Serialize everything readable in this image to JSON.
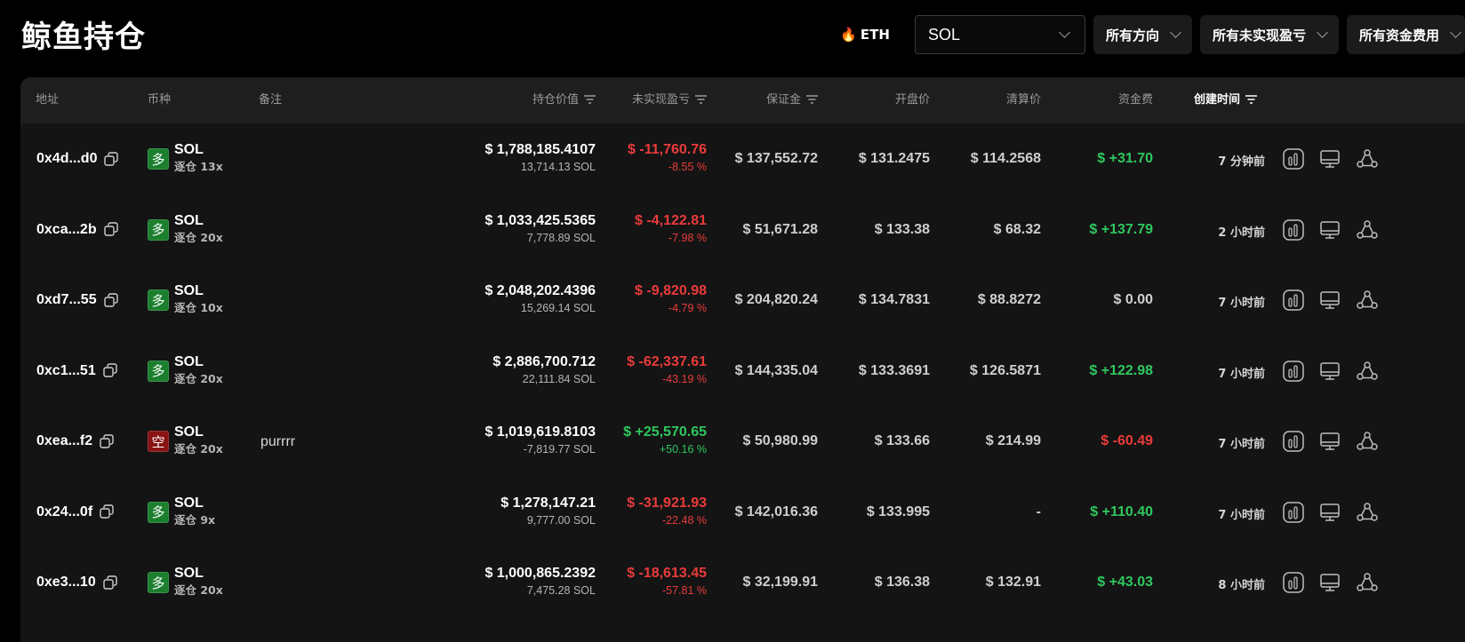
{
  "title": "鲸鱼持仓",
  "filters": {
    "hot_coin_label": "ETH",
    "coin_value": "SOL",
    "direction_label": "所有方向",
    "pnl_label": "所有未实现盈亏",
    "funding_label": "所有资金费用"
  },
  "columns": {
    "address": "地址",
    "coin": "币种",
    "note": "备注",
    "position_value": "持仓价值",
    "unrealized_pnl": "未实现盈亏",
    "margin": "保证金",
    "entry_price": "开盘价",
    "liq_price": "清算价",
    "funding": "资金费",
    "created": "创建时间"
  },
  "colors": {
    "long": "#1b7f2e",
    "short": "#8a1313",
    "profit": "#2fc75f",
    "loss": "#ea3b3b"
  },
  "icons": {
    "hot": "fire-icon",
    "copy": "copy-icon",
    "filter": "filter-icon",
    "actions": [
      "chart-icon",
      "monitor-icon",
      "share-icon"
    ]
  },
  "rows": [
    {
      "address": "0x4d...d0",
      "side": "多",
      "side_type": "long",
      "coin": "SOL",
      "leverage": "逐仓 13x",
      "note": "",
      "value": "$ 1,788,185.4107",
      "size": "13,714.13 SOL",
      "pnl": "$ -11,760.76",
      "pnl_pct": "-8.55 %",
      "pnl_type": "loss",
      "margin": "$ 137,552.72",
      "entry": "$ 131.2475",
      "liq": "$ 114.2568",
      "funding": "$ +31.70",
      "funding_type": "profit",
      "created": "7 分钟前"
    },
    {
      "address": "0xca...2b",
      "side": "多",
      "side_type": "long",
      "coin": "SOL",
      "leverage": "逐仓 20x",
      "note": "",
      "value": "$ 1,033,425.5365",
      "size": "7,778.89 SOL",
      "pnl": "$ -4,122.81",
      "pnl_pct": "-7.98 %",
      "pnl_type": "loss",
      "margin": "$ 51,671.28",
      "entry": "$ 133.38",
      "liq": "$ 68.32",
      "funding": "$ +137.79",
      "funding_type": "profit",
      "created": "2 小时前"
    },
    {
      "address": "0xd7...55",
      "side": "多",
      "side_type": "long",
      "coin": "SOL",
      "leverage": "逐仓 10x",
      "note": "",
      "value": "$ 2,048,202.4396",
      "size": "15,269.14 SOL",
      "pnl": "$ -9,820.98",
      "pnl_pct": "-4.79 %",
      "pnl_type": "loss",
      "margin": "$ 204,820.24",
      "entry": "$ 134.7831",
      "liq": "$ 88.8272",
      "funding": "$ 0.00",
      "funding_type": "neutral",
      "created": "7 小时前"
    },
    {
      "address": "0xc1...51",
      "side": "多",
      "side_type": "long",
      "coin": "SOL",
      "leverage": "逐仓 20x",
      "note": "",
      "value": "$ 2,886,700.712",
      "size": "22,111.84 SOL",
      "pnl": "$ -62,337.61",
      "pnl_pct": "-43.19 %",
      "pnl_type": "loss",
      "margin": "$ 144,335.04",
      "entry": "$ 133.3691",
      "liq": "$ 126.5871",
      "funding": "$ +122.98",
      "funding_type": "profit",
      "created": "7 小时前"
    },
    {
      "address": "0xea...f2",
      "side": "空",
      "side_type": "short",
      "coin": "SOL",
      "leverage": "逐仓 20x",
      "note": "purrrr",
      "value": "$ 1,019,619.8103",
      "size": "-7,819.77 SOL",
      "pnl": "$ +25,570.65",
      "pnl_pct": "+50.16 %",
      "pnl_type": "profit",
      "margin": "$ 50,980.99",
      "entry": "$ 133.66",
      "liq": "$ 214.99",
      "funding": "$ -60.49",
      "funding_type": "loss",
      "created": "7 小时前"
    },
    {
      "address": "0x24...0f",
      "side": "多",
      "side_type": "long",
      "coin": "SOL",
      "leverage": "逐仓 9x",
      "note": "",
      "value": "$ 1,278,147.21",
      "size": "9,777.00 SOL",
      "pnl": "$ -31,921.93",
      "pnl_pct": "-22.48 %",
      "pnl_type": "loss",
      "margin": "$ 142,016.36",
      "entry": "$ 133.995",
      "liq": "-",
      "funding": "$ +110.40",
      "funding_type": "profit",
      "created": "7 小时前"
    },
    {
      "address": "0xe3...10",
      "side": "多",
      "side_type": "long",
      "coin": "SOL",
      "leverage": "逐仓 20x",
      "note": "",
      "value": "$ 1,000,865.2392",
      "size": "7,475.28 SOL",
      "pnl": "$ -18,613.45",
      "pnl_pct": "-57.81 %",
      "pnl_type": "loss",
      "margin": "$ 32,199.91",
      "entry": "$ 136.38",
      "liq": "$ 132.91",
      "funding": "$ +43.03",
      "funding_type": "profit",
      "created": "8 小时前"
    }
  ]
}
